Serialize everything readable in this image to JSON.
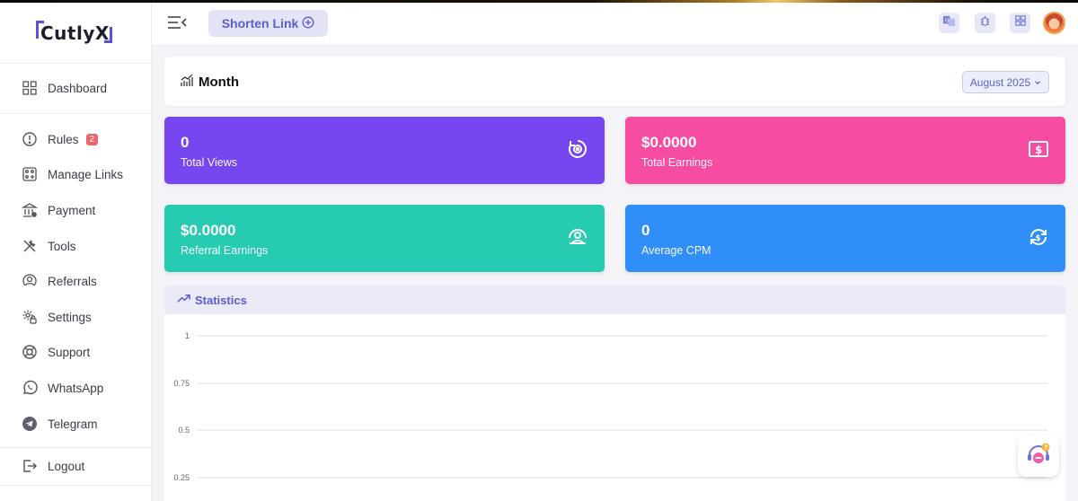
{
  "brand": {
    "logo_text": "CutlyX",
    "accent": "#5b50e0"
  },
  "sidebar": {
    "items": [
      {
        "label": "Dashboard",
        "icon": "dashboard-grid-icon"
      },
      {
        "label": "Rules",
        "icon": "alert-circle-icon",
        "badge": "2"
      },
      {
        "label": "Manage Links",
        "icon": "links-icon"
      },
      {
        "label": "Payment",
        "icon": "bank-icon"
      },
      {
        "label": "Tools",
        "icon": "tools-icon"
      },
      {
        "label": "Referrals",
        "icon": "referrals-icon"
      },
      {
        "label": "Settings",
        "icon": "settings-icon"
      },
      {
        "label": "Support",
        "icon": "lifebuoy-icon"
      },
      {
        "label": "WhatsApp",
        "icon": "whatsapp-icon"
      },
      {
        "label": "Telegram",
        "icon": "telegram-icon"
      },
      {
        "label": "Logout",
        "icon": "logout-icon"
      }
    ]
  },
  "header": {
    "shorten_label": "Shorten Link",
    "icons": [
      "translate-icon",
      "bug-icon",
      "apps-grid-icon"
    ]
  },
  "month_card": {
    "title": "Month",
    "selected_month": "August 2025"
  },
  "stats": [
    {
      "value": "0",
      "label": "Total Views",
      "color": "#7646f0",
      "icon": "views-icon"
    },
    {
      "value": "$0.0000",
      "label": "Total Earnings",
      "color": "#f64ca2",
      "icon": "dollar-note-icon"
    },
    {
      "value": "$0.0000",
      "label": "Referral Earnings",
      "color": "#27cbb2",
      "icon": "referral-group-icon"
    },
    {
      "value": "0",
      "label": "Average CPM",
      "color": "#2f8ef8",
      "icon": "dollar-refresh-icon"
    }
  ],
  "statistics": {
    "title": "Statistics",
    "y_ticks": [
      "1",
      "0.75",
      "0.5",
      "0.25"
    ]
  }
}
